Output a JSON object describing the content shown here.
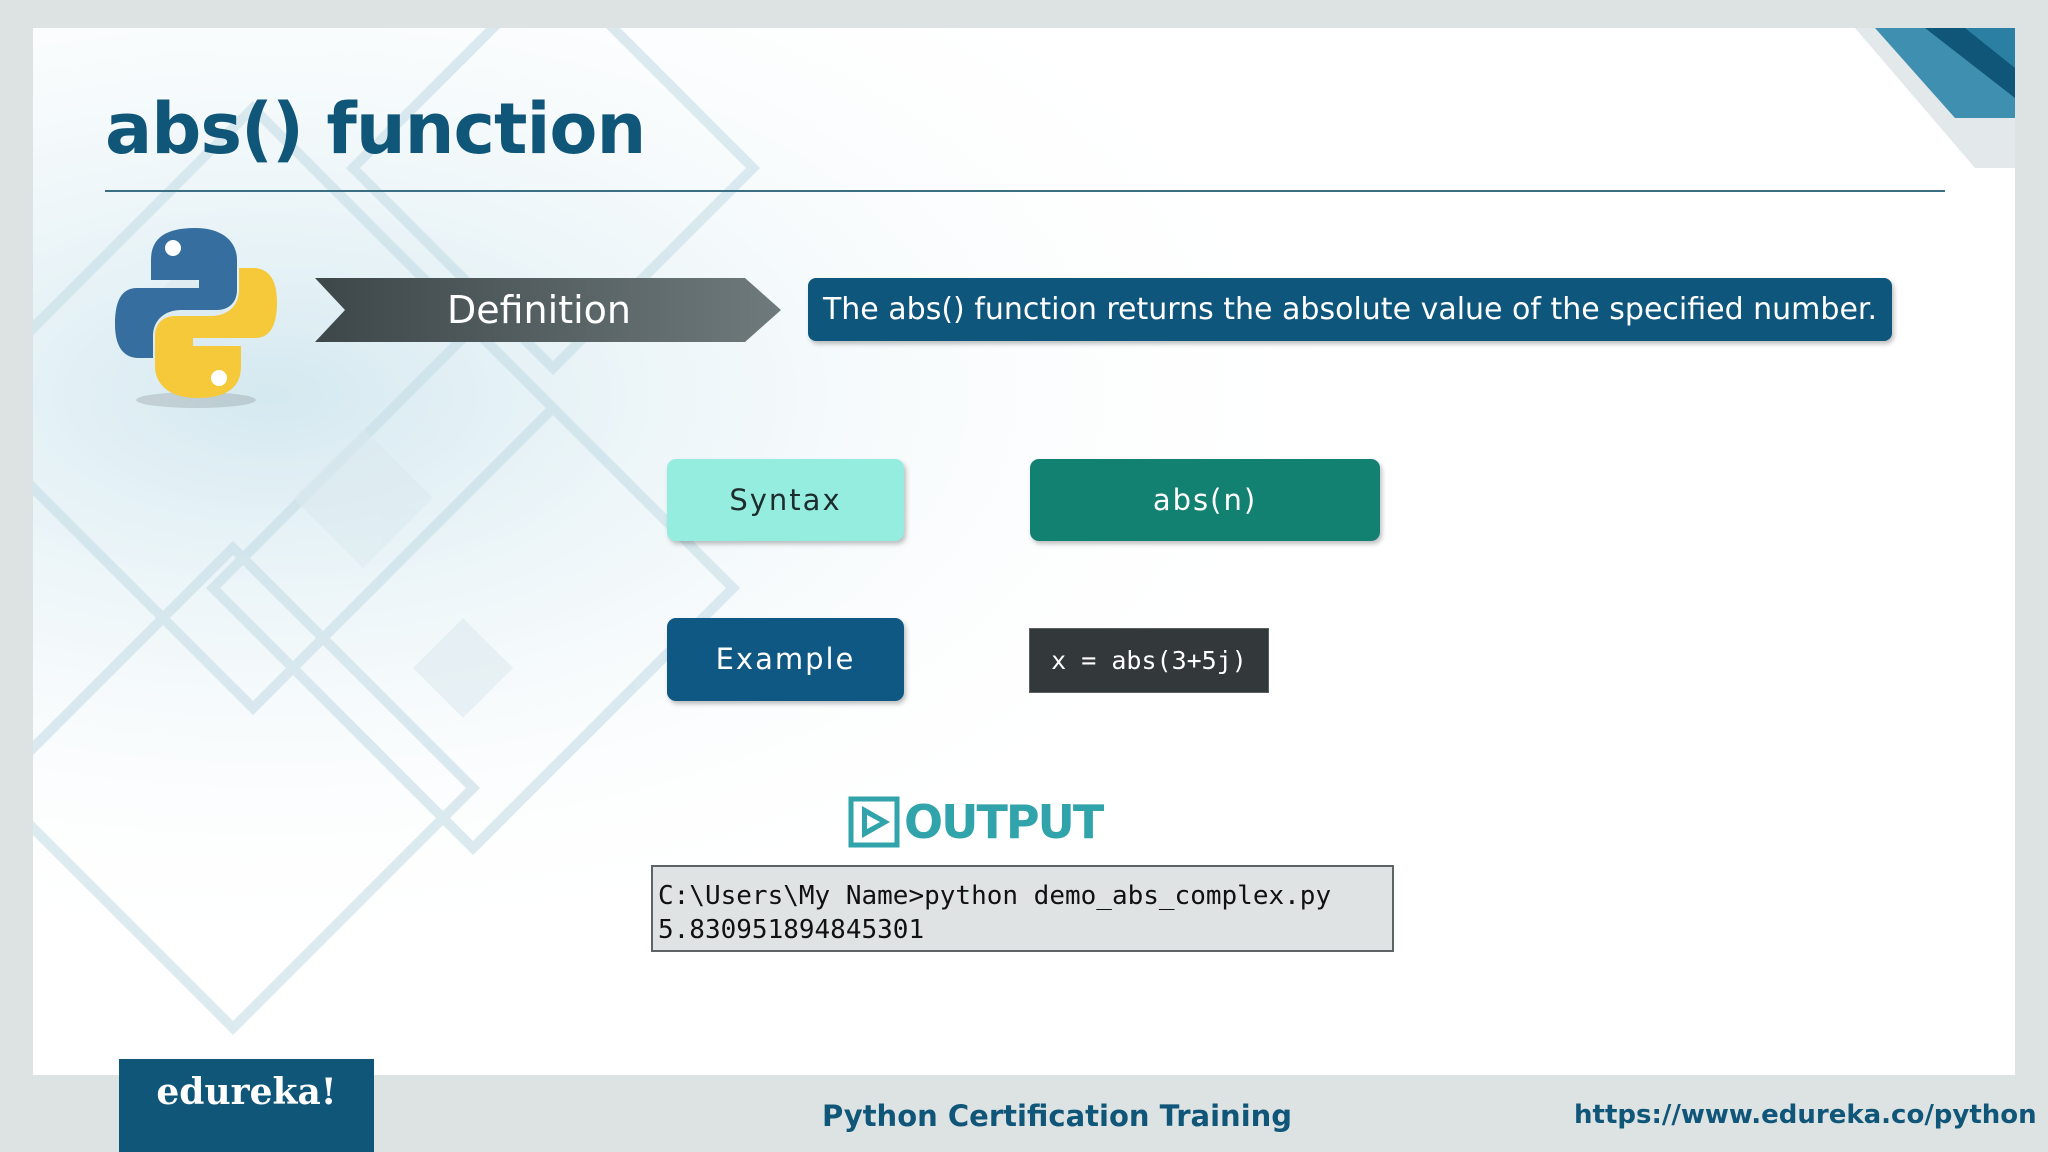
{
  "slide": {
    "title": "abs() function",
    "definition_label": "Definition",
    "definition_text": "The abs() function returns the absolute value of the specified number.",
    "syntax_label": "Syntax",
    "syntax_code": "abs(n)",
    "example_label": "Example",
    "example_code": "x = abs(3+5j)",
    "output_label": "OUTPUT",
    "console_lines": {
      "line1": "C:\\Users\\My Name>python demo_abs_complex.py",
      "line2": "5.830951894845301"
    }
  },
  "footer": {
    "brand": "edureka!",
    "course": "Python Certification Training",
    "url": "https://www.edureka.co/python"
  },
  "colors": {
    "title": "#0f5679",
    "definition_box": "#0f567d",
    "syntax_label_bg": "#95ede0",
    "syntax_code_bg": "#138171",
    "example_label_bg": "#0f5883",
    "example_code_bg": "#33393b",
    "output_accent": "#31a3ab"
  }
}
